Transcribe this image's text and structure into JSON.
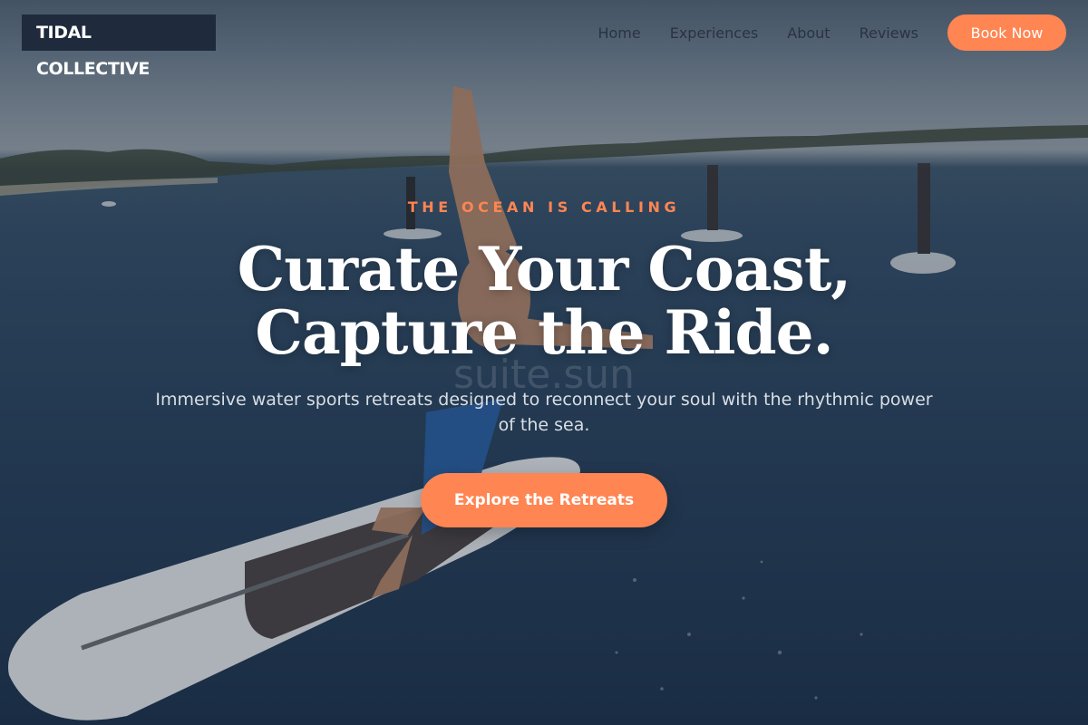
{
  "brand": {
    "name": "TIDAL COLLECTIVE"
  },
  "nav": {
    "links": [
      "Home",
      "Experiences",
      "About",
      "Reviews"
    ],
    "cta_label": "Book Now"
  },
  "hero": {
    "eyebrow": "THE OCEAN IS CALLING",
    "headline_line1": "Curate Your Coast,",
    "headline_line2": "Capture the Ride.",
    "subtitle": "Immersive water sports retreats designed to reconnect your soul with the rhythmic power of the sea.",
    "cta_label": "Explore the Retreats",
    "watermark": "suite.sun"
  },
  "colors": {
    "accent": "#ff8552",
    "logo_bg": "#1f2a3d",
    "nav_text": "#2a3340"
  }
}
